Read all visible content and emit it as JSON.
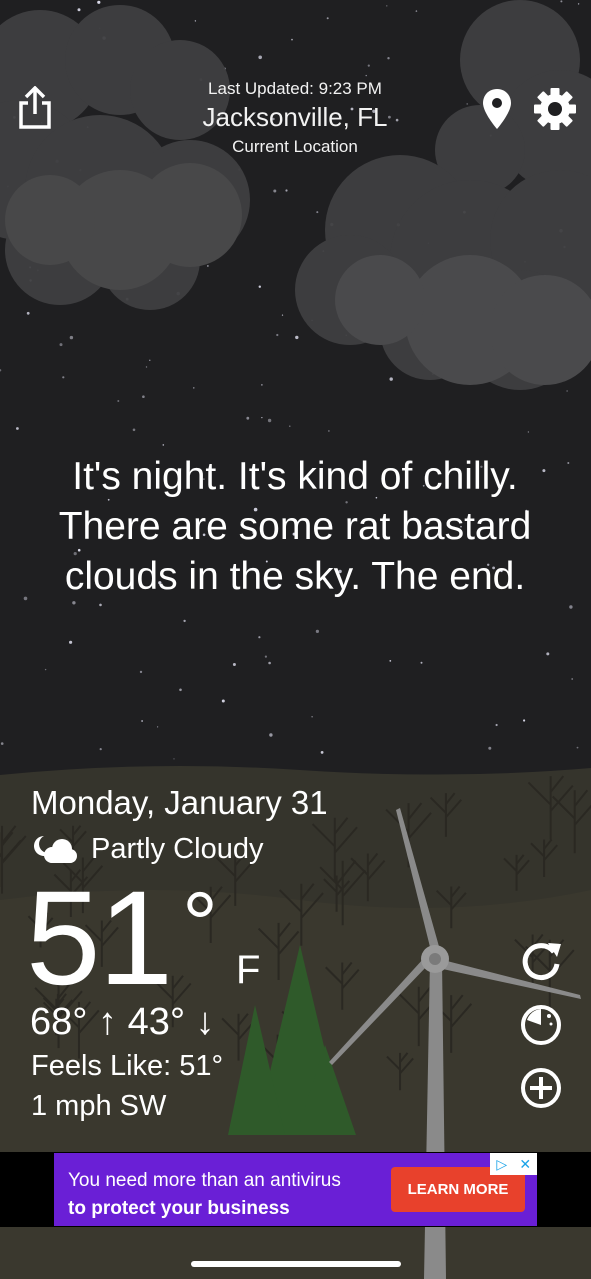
{
  "header": {
    "last_updated": "Last Updated: 9:23 PM",
    "city": "Jacksonville, FL",
    "location_mode": "Current Location"
  },
  "quip": "It's night. It's kind of chilly. There are some rat bastard clouds in the sky. The end.",
  "weather": {
    "date": "Monday, January 31",
    "condition": "Partly Cloudy",
    "condition_icon": "moon-cloud-icon",
    "temperature": "51",
    "degree_symbol": "°",
    "unit": "F",
    "high_low": "68° ↑ 43° ↓",
    "feels_like": "Feels Like: 51°",
    "wind": "1 mph SW"
  },
  "actions": {
    "share_icon": "share-icon",
    "location_icon": "map-pin-icon",
    "settings_icon": "gear-icon",
    "refresh_icon": "refresh-icon",
    "radar_icon": "radar-icon",
    "add_icon": "plus-circle-icon"
  },
  "ad": {
    "line1": "You need more than an antivirus",
    "line2": "to protect your business",
    "cta": "LEARN MORE",
    "colors": {
      "background": "#6a1fd6",
      "cta": "#e8412c"
    }
  },
  "colors": {
    "sky": "#1f1f21",
    "cloud": "#444446",
    "hills": "#3a3a2e",
    "trees": "#2f5a2a",
    "turbine": "#8a8a8a",
    "text": "#ffffff"
  }
}
